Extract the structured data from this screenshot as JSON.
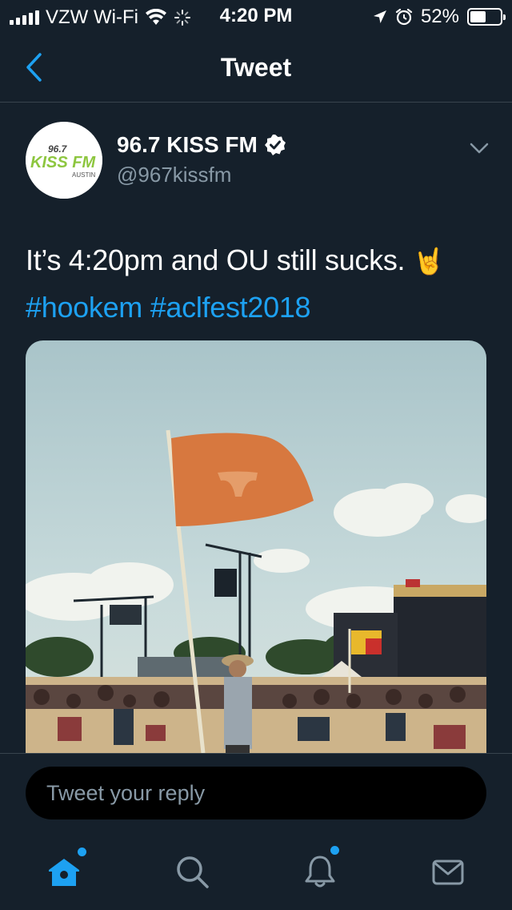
{
  "status_bar": {
    "carrier": "VZW Wi-Fi",
    "time": "4:20 PM",
    "battery": "52%",
    "battery_level": 0.52,
    "icons": [
      "signal-icon",
      "wifi-icon",
      "activity-spinner-icon",
      "location-arrow-icon",
      "alarm-icon",
      "battery-icon"
    ]
  },
  "nav": {
    "title": "Tweet",
    "back_icon": "chevron-left-icon"
  },
  "tweet": {
    "author_name": "96.7 KISS FM",
    "author_handle": "@967kissfm",
    "verified": true,
    "avatar_logo": {
      "freq": "96.7",
      "brand": "KISS FM",
      "city": "AUSTIN"
    },
    "text_before_emoji": "It’s 4:20pm and OU still sucks. ",
    "emoji": "🤘",
    "hashtags": [
      "#hookem",
      "#aclfest2018"
    ],
    "media_description_icon": "photo"
  },
  "reply": {
    "placeholder": "Tweet your reply"
  },
  "tab_bar": {
    "tabs": [
      {
        "name": "home",
        "icon": "home-icon",
        "active": true,
        "notification_dot": true
      },
      {
        "name": "search",
        "icon": "search-icon",
        "active": false,
        "notification_dot": false
      },
      {
        "name": "notifications",
        "icon": "bell-icon",
        "active": false,
        "notification_dot": true
      },
      {
        "name": "messages",
        "icon": "envelope-icon",
        "active": false,
        "notification_dot": false
      }
    ]
  },
  "colors": {
    "background": "#15202b",
    "accent": "#1da1f2",
    "muted": "#8899a6",
    "divider": "#38444d"
  }
}
